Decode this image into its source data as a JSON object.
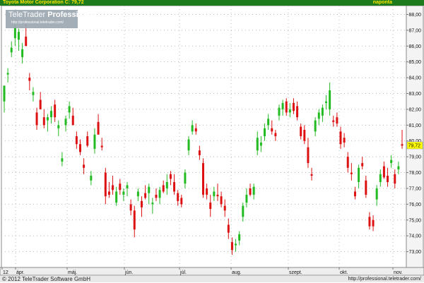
{
  "header": {
    "title": "Toyota Motor Corporation C: 79,72",
    "period": "naponta"
  },
  "logo": {
    "brand_light": "TeleTrader",
    "brand_bold": "Professional",
    "url": "http://professional.teletrader.com/"
  },
  "footer": {
    "copyright": "© 2012 TeleTrader Software GmbH",
    "url": "http://professional.teletrader.com/"
  },
  "colors": {
    "up": "#22bb22",
    "down": "#dd1111",
    "header_bg": "#1d7a1d",
    "last_price_bg": "#ffff00"
  },
  "chart_data": {
    "type": "candlestick",
    "title": "Toyota Motor Corporation C: 79,72",
    "last_price_label": "79,72",
    "y_ticks": [
      "73,00",
      "74,00",
      "75,00",
      "76,00",
      "77,00",
      "78,00",
      "79,00",
      "80,00",
      "81,00",
      "82,00",
      "83,00",
      "84,00",
      "85,00",
      "86,00",
      "87,00",
      "88,00"
    ],
    "ylim": [
      72.2,
      88.4
    ],
    "x_ticks": [
      "12",
      "ápr.",
      "máj.",
      "jún.",
      "júl.",
      "aug.",
      "szept.",
      "okt.",
      "nov."
    ],
    "grid": true,
    "series": [
      {
        "open": 82.5,
        "high": 83.3,
        "low": 81.8,
        "close": 83.5
      },
      {
        "open": 84.2,
        "high": 84.6,
        "low": 83.7,
        "close": 84.3
      },
      {
        "open": 85.6,
        "high": 86.3,
        "low": 85.3,
        "close": 85.9
      },
      {
        "open": 86.5,
        "high": 87.5,
        "low": 86.0,
        "close": 87.2
      },
      {
        "open": 86.4,
        "high": 87.1,
        "low": 85.7,
        "close": 86.9
      },
      {
        "open": 85.3,
        "high": 86.2,
        "low": 84.9,
        "close": 85.8
      },
      {
        "open": 86.6,
        "high": 87.4,
        "low": 86.2,
        "close": 86.0
      },
      {
        "open": 84.0,
        "high": 84.3,
        "low": 83.2,
        "close": 83.8
      },
      {
        "open": 82.9,
        "high": 83.4,
        "low": 82.5,
        "close": 83.1
      },
      {
        "open": 81.8,
        "high": 82.1,
        "low": 80.7,
        "close": 81.0
      },
      {
        "open": 82.6,
        "high": 83.1,
        "low": 82.2,
        "close": 82.0
      },
      {
        "open": 81.5,
        "high": 82.0,
        "low": 80.8,
        "close": 81.0
      },
      {
        "open": 81.3,
        "high": 81.7,
        "low": 80.6,
        "close": 81.5
      },
      {
        "open": 81.5,
        "high": 82.2,
        "low": 81.1,
        "close": 81.9
      },
      {
        "open": 82.3,
        "high": 82.6,
        "low": 81.2,
        "close": 81.5
      },
      {
        "open": 80.8,
        "high": 81.3,
        "low": 80.3,
        "close": 81.0
      },
      {
        "open": 78.7,
        "high": 79.3,
        "low": 78.4,
        "close": 78.9
      },
      {
        "open": 81.0,
        "high": 81.6,
        "low": 80.6,
        "close": 81.4
      },
      {
        "open": 81.8,
        "high": 82.5,
        "low": 81.4,
        "close": 82.2
      },
      {
        "open": 81.6,
        "high": 82.1,
        "low": 81.0,
        "close": 81.0
      },
      {
        "open": 80.3,
        "high": 80.6,
        "low": 79.5,
        "close": 79.8
      },
      {
        "open": 79.8,
        "high": 80.1,
        "low": 79.1,
        "close": 79.3
      },
      {
        "open": 78.5,
        "high": 78.9,
        "low": 77.9,
        "close": 78.3
      },
      {
        "open": 80.3,
        "high": 80.6,
        "low": 79.6,
        "close": 79.7
      },
      {
        "open": 77.5,
        "high": 78.1,
        "low": 77.2,
        "close": 77.8
      },
      {
        "open": 79.5,
        "high": 80.8,
        "low": 79.2,
        "close": 80.4
      },
      {
        "open": 81.2,
        "high": 81.7,
        "low": 80.4,
        "close": 80.4
      },
      {
        "open": 79.7,
        "high": 80.2,
        "low": 79.4,
        "close": 79.6
      },
      {
        "open": 78.0,
        "high": 78.3,
        "low": 76.0,
        "close": 76.5
      },
      {
        "open": 76.8,
        "high": 77.4,
        "low": 76.4,
        "close": 76.6
      },
      {
        "open": 77.2,
        "high": 77.8,
        "low": 76.6,
        "close": 76.9
      },
      {
        "open": 76.1,
        "high": 77.1,
        "low": 75.9,
        "close": 76.8
      },
      {
        "open": 77.3,
        "high": 77.6,
        "low": 76.6,
        "close": 76.9
      },
      {
        "open": 76.6,
        "high": 77.0,
        "low": 76.2,
        "close": 76.8
      },
      {
        "open": 77.0,
        "high": 77.4,
        "low": 76.5,
        "close": 77.2
      },
      {
        "open": 76.0,
        "high": 76.3,
        "low": 75.3,
        "close": 75.6
      },
      {
        "open": 75.6,
        "high": 75.9,
        "low": 73.9,
        "close": 74.4
      },
      {
        "open": 76.5,
        "high": 77.0,
        "low": 76.2,
        "close": 76.8
      },
      {
        "open": 76.2,
        "high": 76.5,
        "low": 75.2,
        "close": 75.8
      },
      {
        "open": 76.7,
        "high": 77.2,
        "low": 76.3,
        "close": 76.4
      },
      {
        "open": 76.7,
        "high": 77.3,
        "low": 76.0,
        "close": 77.1
      },
      {
        "open": 76.0,
        "high": 76.4,
        "low": 75.4,
        "close": 76.1
      },
      {
        "open": 76.6,
        "high": 77.0,
        "low": 76.2,
        "close": 76.4
      },
      {
        "open": 76.4,
        "high": 77.1,
        "low": 76.0,
        "close": 76.9
      },
      {
        "open": 77.2,
        "high": 77.5,
        "low": 76.7,
        "close": 76.8
      },
      {
        "open": 77.0,
        "high": 77.9,
        "low": 76.6,
        "close": 77.4
      },
      {
        "open": 77.9,
        "high": 78.1,
        "low": 77.2,
        "close": 77.6
      },
      {
        "open": 77.4,
        "high": 77.9,
        "low": 76.6,
        "close": 76.8
      },
      {
        "open": 76.7,
        "high": 76.9,
        "low": 75.9,
        "close": 76.2
      },
      {
        "open": 76.4,
        "high": 76.6,
        "low": 75.8,
        "close": 76.0
      },
      {
        "open": 77.3,
        "high": 78.2,
        "low": 77.0,
        "close": 78.0
      },
      {
        "open": 79.4,
        "high": 80.3,
        "low": 79.1,
        "close": 80.1
      },
      {
        "open": 80.6,
        "high": 81.3,
        "low": 80.4,
        "close": 81.0
      },
      {
        "open": 80.8,
        "high": 81.1,
        "low": 80.4,
        "close": 80.6
      },
      {
        "open": 79.4,
        "high": 79.7,
        "low": 78.8,
        "close": 79.1
      },
      {
        "open": 78.6,
        "high": 78.9,
        "low": 76.4,
        "close": 76.6
      },
      {
        "open": 77.0,
        "high": 77.3,
        "low": 76.3,
        "close": 76.6
      },
      {
        "open": 76.1,
        "high": 76.6,
        "low": 75.2,
        "close": 75.7
      },
      {
        "open": 76.5,
        "high": 77.1,
        "low": 76.2,
        "close": 76.8
      },
      {
        "open": 76.6,
        "high": 77.3,
        "low": 76.2,
        "close": 76.5
      },
      {
        "open": 76.5,
        "high": 76.8,
        "low": 75.8,
        "close": 76.0
      },
      {
        "open": 75.9,
        "high": 76.3,
        "low": 75.2,
        "close": 75.6
      },
      {
        "open": 74.7,
        "high": 75.1,
        "low": 73.8,
        "close": 74.2
      },
      {
        "open": 73.6,
        "high": 73.9,
        "low": 72.8,
        "close": 73.1
      },
      {
        "open": 73.4,
        "high": 73.8,
        "low": 73.0,
        "close": 73.5
      },
      {
        "open": 73.7,
        "high": 74.3,
        "low": 73.4,
        "close": 74.1
      },
      {
        "open": 75.2,
        "high": 76.1,
        "low": 74.9,
        "close": 75.9
      },
      {
        "open": 76.1,
        "high": 77.0,
        "low": 75.8,
        "close": 76.6
      },
      {
        "open": 77.0,
        "high": 77.3,
        "low": 76.5,
        "close": 76.6
      },
      {
        "open": 76.6,
        "high": 77.3,
        "low": 76.3,
        "close": 77.1
      },
      {
        "open": 79.4,
        "high": 80.6,
        "low": 79.1,
        "close": 80.2
      },
      {
        "open": 79.7,
        "high": 80.3,
        "low": 79.3,
        "close": 79.9
      },
      {
        "open": 80.3,
        "high": 81.1,
        "low": 80.0,
        "close": 80.8
      },
      {
        "open": 81.0,
        "high": 81.7,
        "low": 80.7,
        "close": 81.4
      },
      {
        "open": 80.8,
        "high": 81.3,
        "low": 80.4,
        "close": 80.6
      },
      {
        "open": 80.5,
        "high": 80.7,
        "low": 80.0,
        "close": 80.3
      },
      {
        "open": 81.6,
        "high": 82.3,
        "low": 81.3,
        "close": 82.1
      },
      {
        "open": 82.0,
        "high": 82.6,
        "low": 81.6,
        "close": 82.4
      },
      {
        "open": 82.5,
        "high": 82.7,
        "low": 81.6,
        "close": 81.8
      },
      {
        "open": 81.8,
        "high": 82.4,
        "low": 81.5,
        "close": 82.0
      },
      {
        "open": 82.4,
        "high": 82.7,
        "low": 81.7,
        "close": 81.9
      },
      {
        "open": 82.2,
        "high": 82.5,
        "low": 81.3,
        "close": 81.5
      },
      {
        "open": 80.9,
        "high": 81.1,
        "low": 80.1,
        "close": 80.3
      },
      {
        "open": 80.7,
        "high": 81.0,
        "low": 79.8,
        "close": 80.0
      },
      {
        "open": 79.6,
        "high": 80.2,
        "low": 78.3,
        "close": 78.6
      },
      {
        "open": 77.9,
        "high": 78.3,
        "low": 77.5,
        "close": 77.8
      },
      {
        "open": 80.6,
        "high": 81.5,
        "low": 80.3,
        "close": 81.3
      },
      {
        "open": 81.4,
        "high": 82.0,
        "low": 81.0,
        "close": 81.8
      },
      {
        "open": 81.6,
        "high": 82.3,
        "low": 81.2,
        "close": 82.1
      },
      {
        "open": 82.4,
        "high": 82.9,
        "low": 82.0,
        "close": 82.5
      },
      {
        "open": 82.0,
        "high": 83.7,
        "low": 81.6,
        "close": 83.2
      },
      {
        "open": 81.3,
        "high": 81.6,
        "low": 80.9,
        "close": 81.2
      },
      {
        "open": 81.5,
        "high": 81.8,
        "low": 80.9,
        "close": 81.1
      },
      {
        "open": 80.6,
        "high": 80.9,
        "low": 79.5,
        "close": 79.8
      },
      {
        "open": 80.2,
        "high": 80.5,
        "low": 79.6,
        "close": 79.9
      },
      {
        "open": 79.0,
        "high": 79.3,
        "low": 78.0,
        "close": 78.3
      },
      {
        "open": 78.0,
        "high": 78.6,
        "low": 77.5,
        "close": 77.9
      },
      {
        "open": 76.8,
        "high": 77.1,
        "low": 76.3,
        "close": 76.5
      },
      {
        "open": 77.4,
        "high": 78.5,
        "low": 77.0,
        "close": 78.3
      },
      {
        "open": 78.6,
        "high": 79.0,
        "low": 78.2,
        "close": 78.4
      },
      {
        "open": 77.5,
        "high": 77.8,
        "low": 76.4,
        "close": 76.6
      },
      {
        "open": 75.2,
        "high": 75.5,
        "low": 74.4,
        "close": 74.6
      },
      {
        "open": 75.0,
        "high": 75.3,
        "low": 74.3,
        "close": 74.6
      },
      {
        "open": 76.3,
        "high": 77.2,
        "low": 75.9,
        "close": 77.0
      },
      {
        "open": 77.4,
        "high": 78.2,
        "low": 77.1,
        "close": 77.9
      },
      {
        "open": 78.4,
        "high": 78.7,
        "low": 77.6,
        "close": 77.7
      },
      {
        "open": 77.8,
        "high": 78.3,
        "low": 77.1,
        "close": 77.4
      },
      {
        "open": 78.6,
        "high": 79.1,
        "low": 78.3,
        "close": 78.8
      },
      {
        "open": 77.9,
        "high": 78.2,
        "low": 77.0,
        "close": 77.3
      },
      {
        "open": 78.2,
        "high": 78.7,
        "low": 77.9,
        "close": 78.4
      },
      {
        "open": 79.8,
        "high": 80.7,
        "low": 79.5,
        "close": 79.7
      }
    ]
  }
}
